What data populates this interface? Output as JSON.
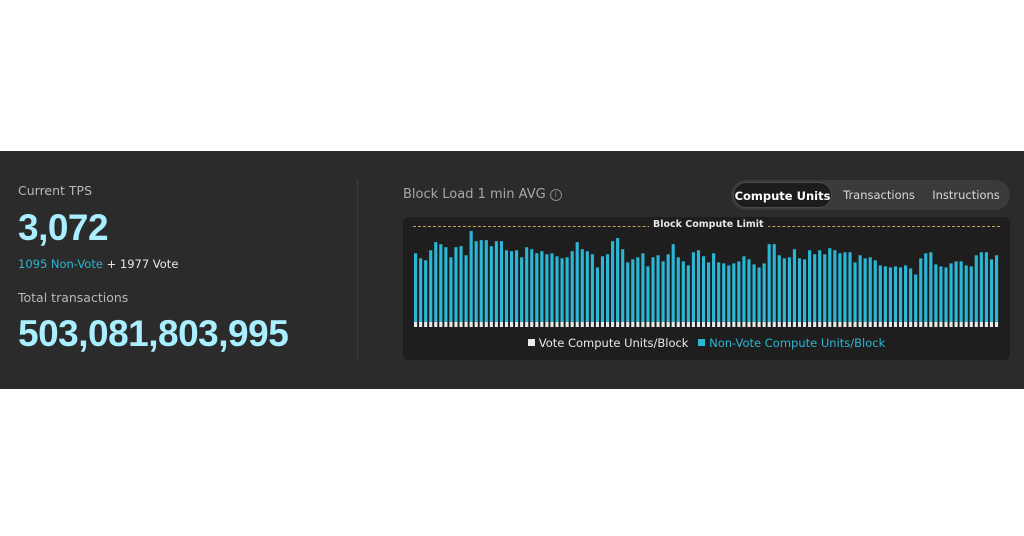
{
  "stats": {
    "current_tps_label": "Current TPS",
    "current_tps_value": "3,072",
    "nonvote_text": "1095 Non-Vote",
    "plus_text": " + ",
    "vote_text": "1977 Vote",
    "total_label": "Total transactions",
    "total_value": "503,081,803,995"
  },
  "chart_header": {
    "title": "Block Load 1 min AVG",
    "info_icon": "i"
  },
  "tabs": [
    {
      "label": "Compute Units",
      "active": true
    },
    {
      "label": "Transactions",
      "active": false
    },
    {
      "label": "Instructions",
      "active": false
    }
  ],
  "colors": {
    "vote": "#e9e9e9",
    "nonvote": "#2bb6d6",
    "accent": "#a9efff",
    "limit_line": "#c9a15a"
  },
  "chart_data": {
    "type": "bar",
    "stacked": true,
    "title": "",
    "limit_label": "Block Compute Limit",
    "ylim": [
      0,
      100
    ],
    "limit_value": 100,
    "series": [
      {
        "name": "Vote Compute Units/Block",
        "values": [
          5,
          5,
          5,
          5,
          5,
          5,
          5,
          5,
          5,
          5,
          5,
          5,
          5,
          5,
          5,
          5,
          5,
          5,
          5,
          5,
          5,
          5,
          5,
          5,
          5,
          5,
          5,
          5,
          5,
          5,
          5,
          5,
          5,
          5,
          5,
          5,
          5,
          5,
          5,
          5,
          5,
          5,
          5,
          5,
          5,
          5,
          5,
          5,
          5,
          5,
          5,
          5,
          5,
          5,
          5,
          5,
          5,
          5,
          5,
          5,
          5,
          5,
          5,
          5,
          5,
          5,
          5,
          5,
          5,
          5,
          5,
          5,
          5,
          5,
          5,
          5,
          5,
          5,
          5,
          5,
          5,
          5,
          5,
          5,
          5,
          5,
          5,
          5,
          5,
          5,
          5,
          5,
          5,
          5,
          5,
          5,
          5,
          5,
          5,
          5,
          5,
          5,
          5,
          5,
          5,
          5,
          5,
          5,
          5,
          5,
          5,
          5,
          5,
          5,
          5,
          5
        ]
      },
      {
        "name": "Non-Vote Compute Units/Block",
        "values": [
          68,
          63,
          61,
          71,
          79,
          77,
          74,
          64,
          74,
          75,
          66,
          90,
          80,
          81,
          81,
          75,
          80,
          80,
          71,
          70,
          71,
          64,
          74,
          72,
          68,
          70,
          67,
          68,
          65,
          63,
          64,
          70,
          79,
          72,
          70,
          67,
          54,
          65,
          67,
          80,
          83,
          72,
          59,
          62,
          64,
          68,
          55,
          64,
          66,
          60,
          67,
          77,
          64,
          60,
          56,
          69,
          71,
          65,
          59,
          68,
          59,
          58,
          56,
          58,
          60,
          65,
          62,
          57,
          54,
          58,
          77,
          77,
          66,
          63,
          64,
          72,
          63,
          62,
          71,
          67,
          71,
          67,
          73,
          71,
          68,
          69,
          69,
          59,
          66,
          63,
          64,
          61,
          56,
          55,
          54,
          55,
          54,
          56,
          53,
          47,
          63,
          68,
          69,
          57,
          55,
          54,
          58,
          60,
          60,
          56,
          55,
          66,
          69,
          69,
          62,
          66
        ]
      }
    ],
    "legend_position": "bottom"
  }
}
